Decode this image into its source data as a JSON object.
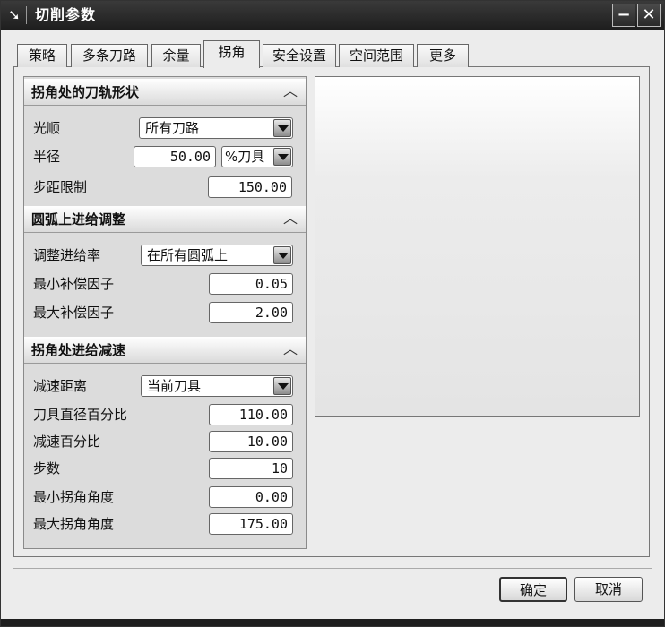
{
  "window": {
    "title": "切削参数",
    "minimize_glyph": "−",
    "close_glyph": "✕",
    "icon": "arrow-pointer-icon"
  },
  "tabs": [
    {
      "label": "策略",
      "active": false
    },
    {
      "label": "多条刀路",
      "active": false
    },
    {
      "label": "余量",
      "active": false
    },
    {
      "label": "拐角",
      "active": true
    },
    {
      "label": "安全设置",
      "active": false
    },
    {
      "label": "空间范围",
      "active": false
    },
    {
      "label": "更多",
      "active": false
    }
  ],
  "sections": {
    "corner_shape": {
      "title": "拐角处的刀轨形状",
      "smooth_label": "光顺",
      "smooth_value": "所有刀路",
      "radius_label": "半径",
      "radius_value": "50.00",
      "radius_unit": "%刀具",
      "step_limit_label": "步距限制",
      "step_limit_value": "150.00"
    },
    "arc_feed": {
      "title": "圆弧上进给调整",
      "adjust_label": "调整进给率",
      "adjust_value": "在所有圆弧上",
      "min_factor_label": "最小补偿因子",
      "min_factor_value": "0.05",
      "max_factor_label": "最大补偿因子",
      "max_factor_value": "2.00"
    },
    "corner_slowdown": {
      "title": "拐角处进给减速",
      "distance_label": "减速距离",
      "distance_value": "当前刀具",
      "tool_dia_label": "刀具直径百分比",
      "tool_dia_value": "110.00",
      "slowdown_pct_label": "减速百分比",
      "slowdown_pct_value": "10.00",
      "steps_label": "步数",
      "steps_value": "10",
      "min_angle_label": "最小拐角角度",
      "min_angle_value": "0.00",
      "max_angle_label": "最大拐角角度",
      "max_angle_value": "175.00"
    }
  },
  "buttons": {
    "ok": "确定",
    "cancel": "取消"
  },
  "colors": {
    "titlebar": "#2a2a2a",
    "panel": "#dcdcdc",
    "dialog": "#ececec"
  }
}
